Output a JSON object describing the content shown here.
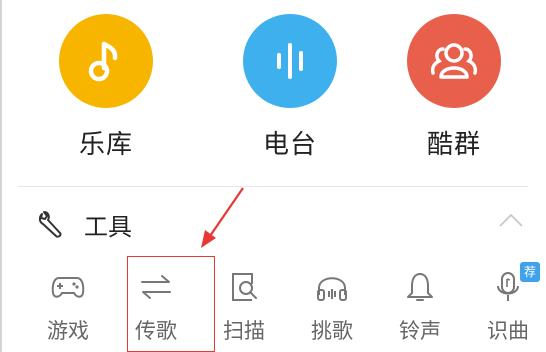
{
  "colors": {
    "music_library": "#f7b500",
    "radio": "#3fb0ee",
    "groups": "#e8604c",
    "annotation_red": "#e53935"
  },
  "features": [
    {
      "label": "乐库",
      "icon": "music-note-icon"
    },
    {
      "label": "电台",
      "icon": "sound-wave-icon"
    },
    {
      "label": "酷群",
      "icon": "group-icon"
    }
  ],
  "tools_section": {
    "title": "工具",
    "icon": "wrench-icon",
    "collapse_icon": "chevron-up-icon"
  },
  "tools": [
    {
      "label": "游戏",
      "icon": "gamepad-icon"
    },
    {
      "label": "传歌",
      "icon": "transfer-arrows-icon"
    },
    {
      "label": "扫描",
      "icon": "scan-icon"
    },
    {
      "label": "挑歌",
      "icon": "headphones-icon"
    },
    {
      "label": "铃声",
      "icon": "bell-icon"
    },
    {
      "label": "识曲",
      "icon": "microphone-icon",
      "badge": "荐"
    }
  ]
}
